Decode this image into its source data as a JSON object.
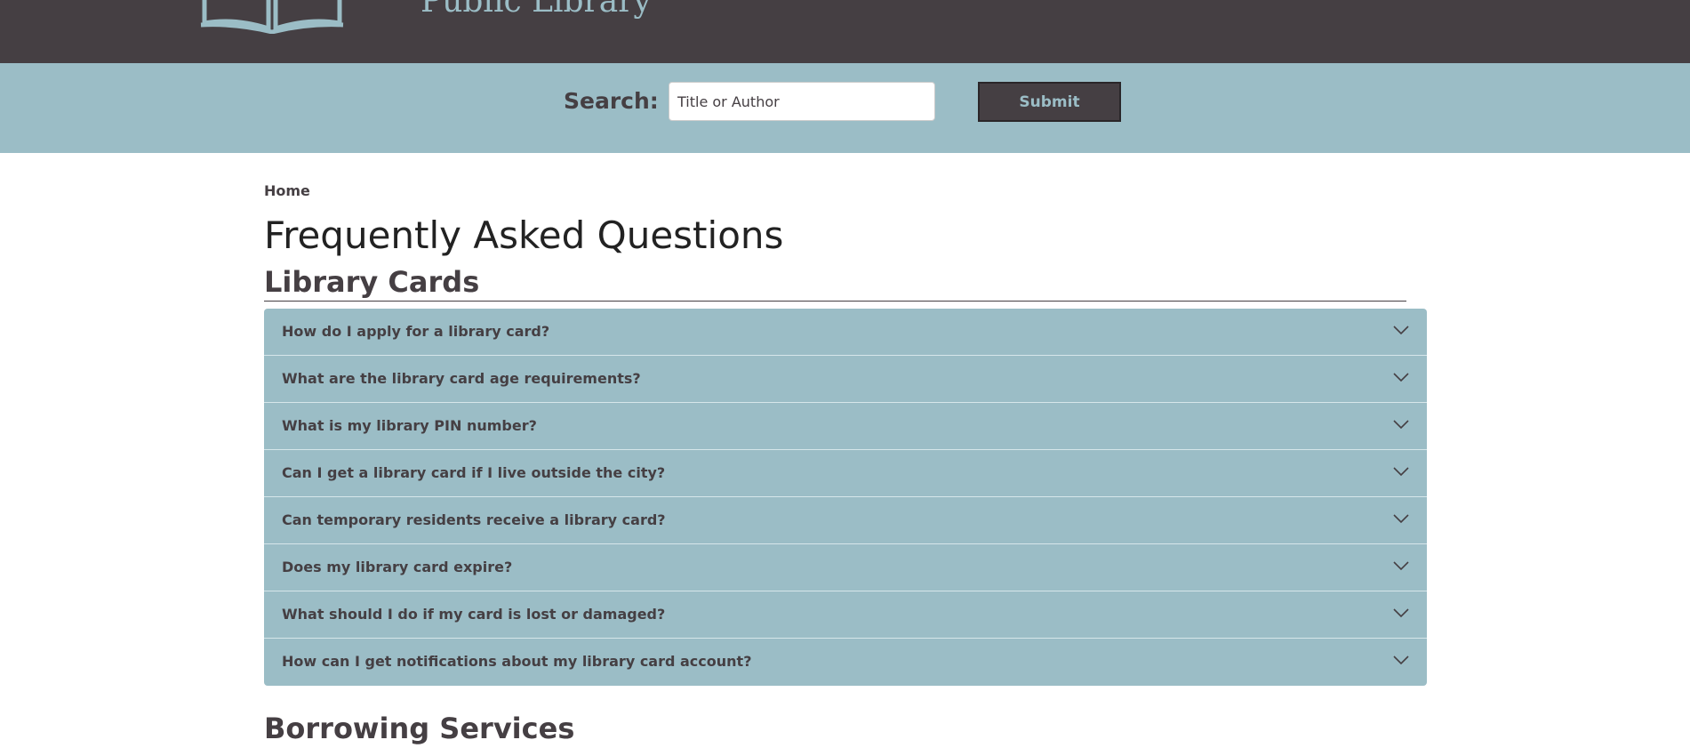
{
  "header": {
    "library_name": "Public Library",
    "logo_icon": "open-book-icon"
  },
  "search": {
    "label": "Search:",
    "placeholder": "Title or Author",
    "value": "",
    "submit_label": "Submit"
  },
  "breadcrumb": {
    "home": "Home"
  },
  "page": {
    "title": "Frequently Asked Questions"
  },
  "sections": [
    {
      "heading": "Library Cards",
      "questions": [
        "How do I apply for a library card?",
        "What are the library card age requirements?",
        "What is my library PIN number?",
        "Can I get a library card if I live outside the city?",
        "Can temporary residents receive a library card?",
        "Does my library card expire?",
        "What should I do if my card is lost or damaged?",
        "How can I get notifications about my library card account?"
      ]
    },
    {
      "heading": "Borrowing Services"
    }
  ],
  "icons": {
    "accordion_toggle": "chevron-down-icon"
  },
  "colors": {
    "dark": "#453f43",
    "accent": "#9bbdc6",
    "background": "#ffffff"
  }
}
